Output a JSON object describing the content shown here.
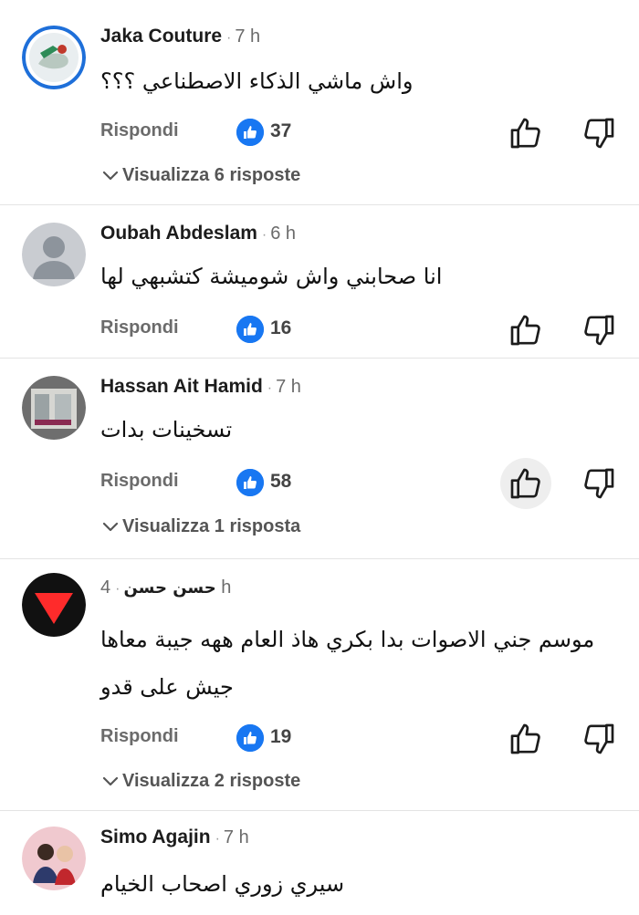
{
  "comments": [
    {
      "author": "Jaka Couture",
      "time": "7 h",
      "text": "واش ماشي الذكاء الاصطناعي ؟؟؟",
      "reply_label": "Rispondi",
      "likes": "37",
      "view_replies": "Visualizza 6 risposte"
    },
    {
      "author": "Oubah Abdeslam",
      "time": "6 h",
      "text": "انا صحابني واش شوميشة كتشبهي لها",
      "reply_label": "Rispondi",
      "likes": "16"
    },
    {
      "author": "Hassan Ait Hamid",
      "time": "7 h",
      "text": "تسخينات بدات",
      "reply_label": "Rispondi",
      "likes": "58",
      "view_replies": "Visualizza 1 risposta"
    },
    {
      "author": "حسن حسن",
      "time": "4 h",
      "text_line1": "موسم جني الاصوات بدا بكري هاذ العام ههه جيبة معاها",
      "text_line2": "جيش على قدو",
      "reply_label": "Rispondi",
      "likes": "19",
      "view_replies": "Visualizza 2 risposte"
    },
    {
      "author": "Simo Agajin",
      "time": "7 h",
      "text": "سيري زوري اصحاب الخيام"
    }
  ],
  "icons": {
    "like_badge": "thumbs-up-icon",
    "upvote": "thumb-up-outline-icon",
    "downvote": "thumb-down-outline-icon",
    "expand": "chevron-down-icon"
  },
  "colors": {
    "like_badge": "#1877f2",
    "secondary_text": "#6b6b6b"
  }
}
